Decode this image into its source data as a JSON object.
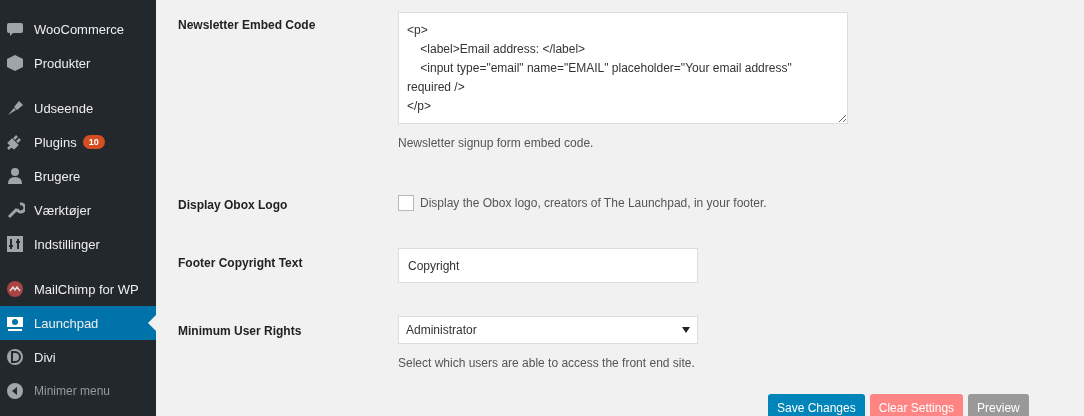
{
  "sidebar": {
    "groups": [
      [
        {
          "label": "WooCommerce",
          "selected": false
        },
        {
          "label": "Produkter",
          "selected": false
        }
      ],
      [
        {
          "label": "Udseende",
          "selected": false
        },
        {
          "label": "Plugins",
          "selected": false,
          "badge": "10"
        },
        {
          "label": "Brugere",
          "selected": false
        },
        {
          "label": "Værktøjer",
          "selected": false
        },
        {
          "label": "Indstillinger",
          "selected": false
        }
      ],
      [
        {
          "label": "MailChimp for WP",
          "selected": false
        },
        {
          "label": "Launchpad",
          "selected": true
        },
        {
          "label": "Divi",
          "selected": false
        },
        {
          "label": "Minimer menu",
          "selected": false,
          "kind": "collapse"
        }
      ]
    ]
  },
  "settings": [
    {
      "kind": "textarea",
      "label": "Newsletter Embed Code",
      "value": "<p>\n\t<label>Email address: </label>\n\t<input type=\"email\" name=\"EMAIL\" placeholder=\"Your email address\" required />\n</p>",
      "help": "Newsletter signup form embed code."
    },
    {
      "kind": "checkbox",
      "label": "Display Obox Logo",
      "checked": false,
      "text": "Display the Obox logo, creators of The Launchpad, in your footer."
    },
    {
      "kind": "text",
      "label": "Footer Copyright Text",
      "value": "Copyright"
    },
    {
      "kind": "select",
      "label": "Minimum User Rights",
      "value": "Administrator",
      "help": "Select which users are able to access the front end site."
    }
  ],
  "buttons": [
    {
      "label": "Save Changes",
      "kind": "primary"
    },
    {
      "label": "Clear Settings",
      "kind": "danger"
    },
    {
      "label": "Preview",
      "kind": "secondary"
    }
  ]
}
